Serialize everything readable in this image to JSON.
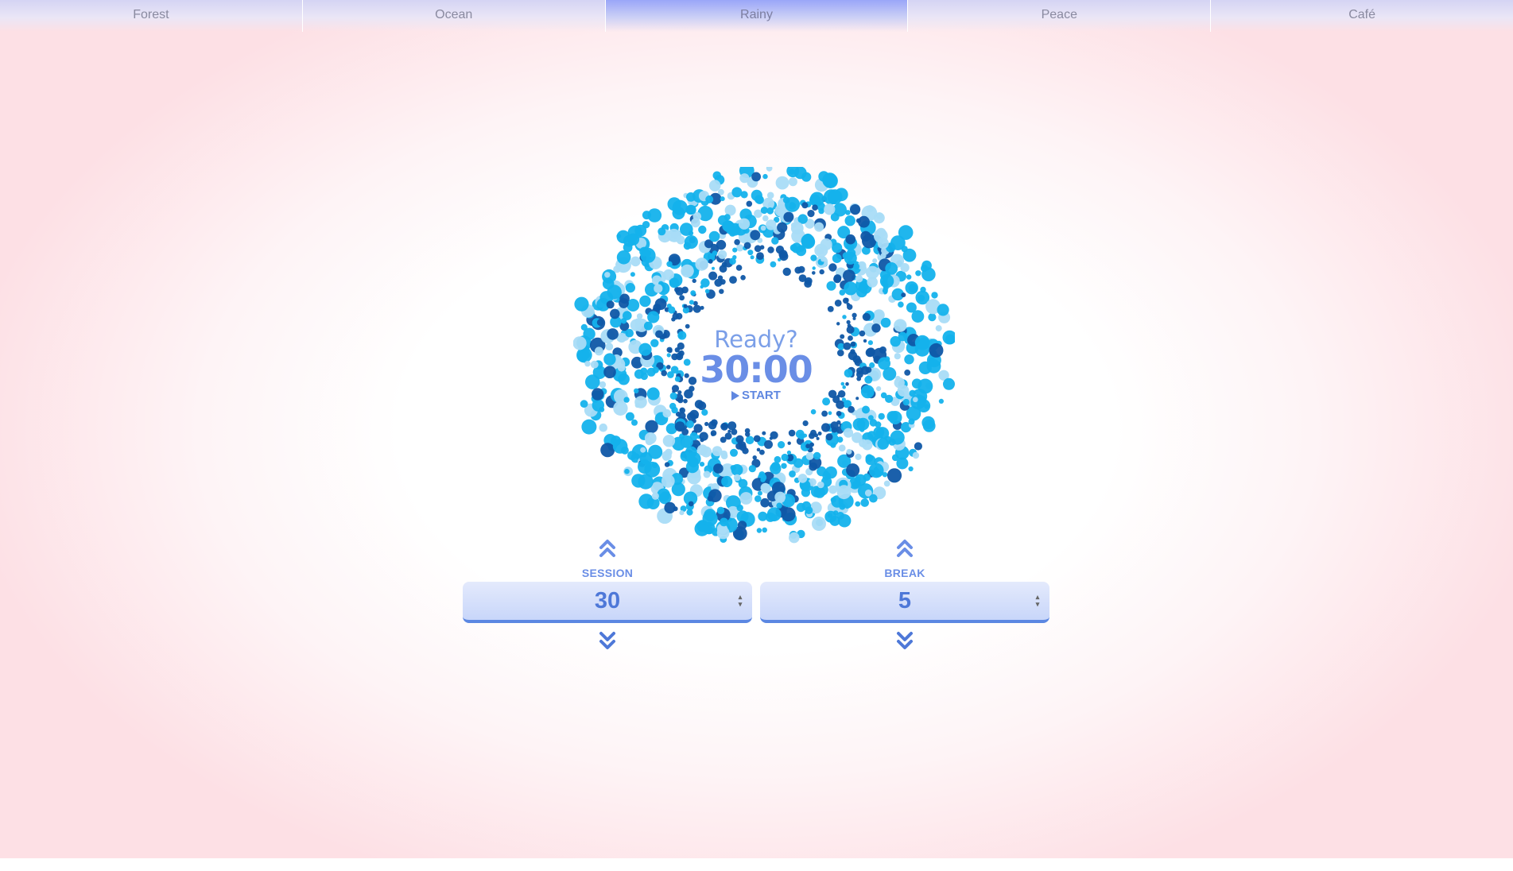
{
  "tabs": [
    {
      "label": "Forest"
    },
    {
      "label": "Ocean"
    },
    {
      "label": "Rainy"
    },
    {
      "label": "Peace"
    },
    {
      "label": "Café"
    }
  ],
  "active_tab": "Rainy",
  "timer": {
    "status": "Ready?",
    "time": "30:00",
    "start_label": "START"
  },
  "session": {
    "label": "SESSION",
    "value": "30"
  },
  "break": {
    "label": "BREAK",
    "value": "5"
  },
  "colors": {
    "accent": "#6a8ee6",
    "ring_light": "#a9dcf7",
    "ring_mid": "#14b2ec",
    "ring_dark": "#0f57a6",
    "active_tab": "#9aa6f8"
  },
  "icons": {
    "increase": "chevron-double-up-icon",
    "decrease": "chevron-double-down-icon",
    "start": "play-icon"
  }
}
